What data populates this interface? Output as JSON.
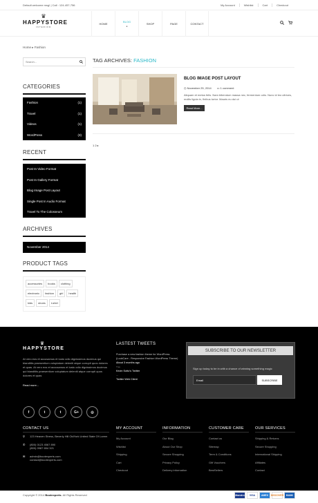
{
  "topbar": {
    "welcome": "Default welcome msg! | Call : 124-457-756",
    "links": [
      "My Account",
      "Wishlist",
      "Cart",
      "Checkout"
    ]
  },
  "logo": {
    "name": "HAPPYSTORE",
    "sub": "INTERIOR"
  },
  "nav": [
    "HOME",
    "BLOG",
    "SHOP",
    "PAGE",
    "CONTACT"
  ],
  "breadcrumb": {
    "home": "Home",
    "sep": "▸",
    "current": "Fashion"
  },
  "search": {
    "placeholder": "Search..."
  },
  "categories": {
    "title": "CATEGORIES",
    "items": [
      {
        "label": "Fashion",
        "count": "(1)"
      },
      {
        "label": "Travel",
        "count": "(1)"
      },
      {
        "label": "Videos",
        "count": "(1)"
      },
      {
        "label": "WordPress",
        "count": "(3)"
      }
    ]
  },
  "recent": {
    "title": "RECENT",
    "items": [
      "Post In Video Format",
      "Post In Gallery Format",
      "Blog Image Post Layout",
      "Single Post In Audio Format",
      "Travel To The Colosseum"
    ]
  },
  "archives": {
    "title": "ARCHIVES",
    "items": [
      "November 2014"
    ]
  },
  "tags": {
    "title": "PRODUCT TAGS",
    "items": [
      "accessories",
      "books",
      "clothing",
      "electronic",
      "fashion",
      "girl",
      "health",
      "kids",
      "shoes",
      "t-shirt"
    ]
  },
  "main": {
    "heading_prefix": "TAG ARCHIVES:",
    "heading_accent": "FASHION",
    "post": {
      "title": "BLOG IMAGE POST LAYOUT",
      "date": "November 25, 2014",
      "comments": "1 comment",
      "excerpt": "Aliquam et metus felis. Nam bibendum massa nec, fermentum odio. Nunc id leo ultrices, mollis ligula in, finibus tortor. Mauris eu dui ut",
      "readmore": "Read More..."
    },
    "pager": "1 2 ▸"
  },
  "footer": {
    "logo": "HAPPYSTORE",
    "about": "At vero eos et accusamus et iusto odio dignissimos ducimus qui blanditiis praesentium voluptatum deleniti atque corrupti quos dolores et quas. At vero eos et accusamus et iusto odio dignissimos ducimus qui blanditiis praesentium voluptatum deleniti atque corrupti quos dolores et quas",
    "more": "Read more...",
    "socials": [
      "f",
      "t",
      "t",
      "G+",
      "◎"
    ],
    "tweets_title": "LASTEST TWEETS",
    "tweets": [
      "Purchase a new fashion theme for WordPress (LookCare - Responsive Fashion WordPress Theme)",
      "About 3 months ago",
      "Tree",
      "Kevin Sotto's Twitter",
      "Twitter Web Client"
    ],
    "newsletter": {
      "title": "SUBSCRIBE TO OUR NEWSLETTER",
      "text": "Sign up today to be in with a chance of winning something magic",
      "placeholder": "Email",
      "button": "SUBSCRIBE"
    },
    "contact": {
      "title": "CONTACT US",
      "address": "123 Heaven Stress, Beverly Hill OldYork United State Of Lorem",
      "phone1": "(800) 0123 4567 890",
      "phone2": "(800) 0987 654 321",
      "email1": "admin@bootexperts.com",
      "email2": "contact@bootexperts.com"
    },
    "columns": [
      {
        "title": "MY ACCOUNT",
        "items": [
          "My Account",
          "Wishlist",
          "Shipping",
          "Cart",
          "Checkout"
        ]
      },
      {
        "title": "INFORMATION",
        "items": [
          "Our Blog",
          "About Our Shop",
          "Secure Shopping",
          "Privacy Policy",
          "Delivery information"
        ]
      },
      {
        "title": "CUSTOMER CARE",
        "items": [
          "Contact us",
          "Sitemap",
          "Term & Conditions",
          "Gift Vouchers",
          "BestSellers"
        ]
      },
      {
        "title": "OUR SERVICES",
        "items": [
          "Shipping & Returns",
          "Secure Shopping",
          "International Shipping",
          "Affiliates",
          "Contact"
        ]
      }
    ],
    "copyright_prefix": "Copyright © 2014",
    "copyright_brand": "Bootexperts",
    "copyright_suffix": ". All Rights Reserved",
    "cards": [
      "Maestro",
      "VISA",
      "AMEX",
      "DISCOVER",
      "BANK"
    ]
  }
}
